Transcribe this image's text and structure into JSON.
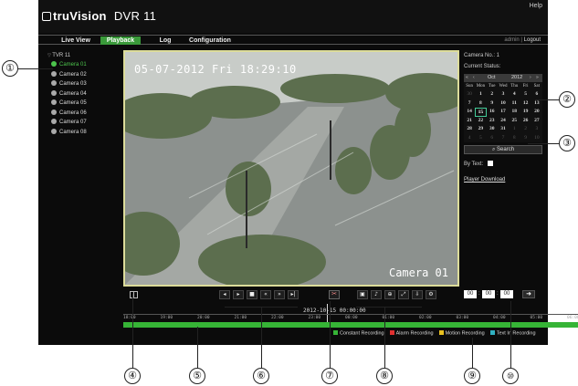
{
  "header": {
    "brand": "truVision",
    "model": "DVR 11",
    "help": "Help"
  },
  "nav": {
    "tabs": [
      {
        "label": "Live View"
      },
      {
        "label": "Playback"
      },
      {
        "label": "Log"
      },
      {
        "label": "Configuration"
      }
    ],
    "active_tab": "Playback",
    "user": "admin",
    "logout": "Logout"
  },
  "tree": {
    "root": "TVR 11",
    "cameras": [
      "Camera 01",
      "Camera 02",
      "Camera 03",
      "Camera 04",
      "Camera 05",
      "Camera 06",
      "Camera 07",
      "Camera 08"
    ],
    "selected": "Camera 01"
  },
  "video": {
    "osd_time": "05-07-2012 Fri 18:29:10",
    "osd_camera": "Camera 01"
  },
  "panel": {
    "camera_no": "Camera No.: 1",
    "current_status": "Current Status:",
    "calendar": {
      "month": "Oct",
      "year": "2012",
      "dow": [
        "Sun",
        "Mon",
        "Tue",
        "Wed",
        "Thu",
        "Fri",
        "Sat"
      ],
      "cells": [
        "30",
        "1",
        "2",
        "3",
        "4",
        "5",
        "6",
        "7",
        "8",
        "9",
        "10",
        "11",
        "12",
        "13",
        "14",
        "15",
        "16",
        "17",
        "18",
        "19",
        "20",
        "21",
        "22",
        "23",
        "24",
        "25",
        "26",
        "27",
        "28",
        "29",
        "30",
        "31",
        "1",
        "2",
        "3",
        "4",
        "5",
        "6",
        "7",
        "8",
        "9",
        "10"
      ],
      "today": "15"
    },
    "search": "Search",
    "by_text": "By Text:",
    "player_download": "Player Download"
  },
  "controls": {
    "time_inputs": [
      "00",
      "00",
      "00"
    ],
    "go_icon": "arrow-right-icon"
  },
  "timeline": {
    "date_label": "2012-10-15 00:00:00",
    "ticks": [
      "18:00",
      "19:00",
      "20:00",
      "21:00",
      "22:00",
      "23:00",
      "00:00",
      "01:00",
      "02:00",
      "03:00",
      "04:00",
      "05:00",
      "06:00"
    ],
    "legend": [
      {
        "label": "Constant Recording",
        "color": "#36b436"
      },
      {
        "label": "Alarm Recording",
        "color": "#e03030"
      },
      {
        "label": "Motion Recording",
        "color": "#e8c020"
      },
      {
        "label": "Text In Recording",
        "color": "#30b0c0"
      }
    ]
  },
  "callouts": [
    "①",
    "②",
    "③",
    "④",
    "⑤",
    "⑥",
    "⑦",
    "⑧",
    "⑨",
    "⑩"
  ],
  "colors": {
    "accent_green": "#3a9a3a",
    "background": "#0b0b0b"
  }
}
